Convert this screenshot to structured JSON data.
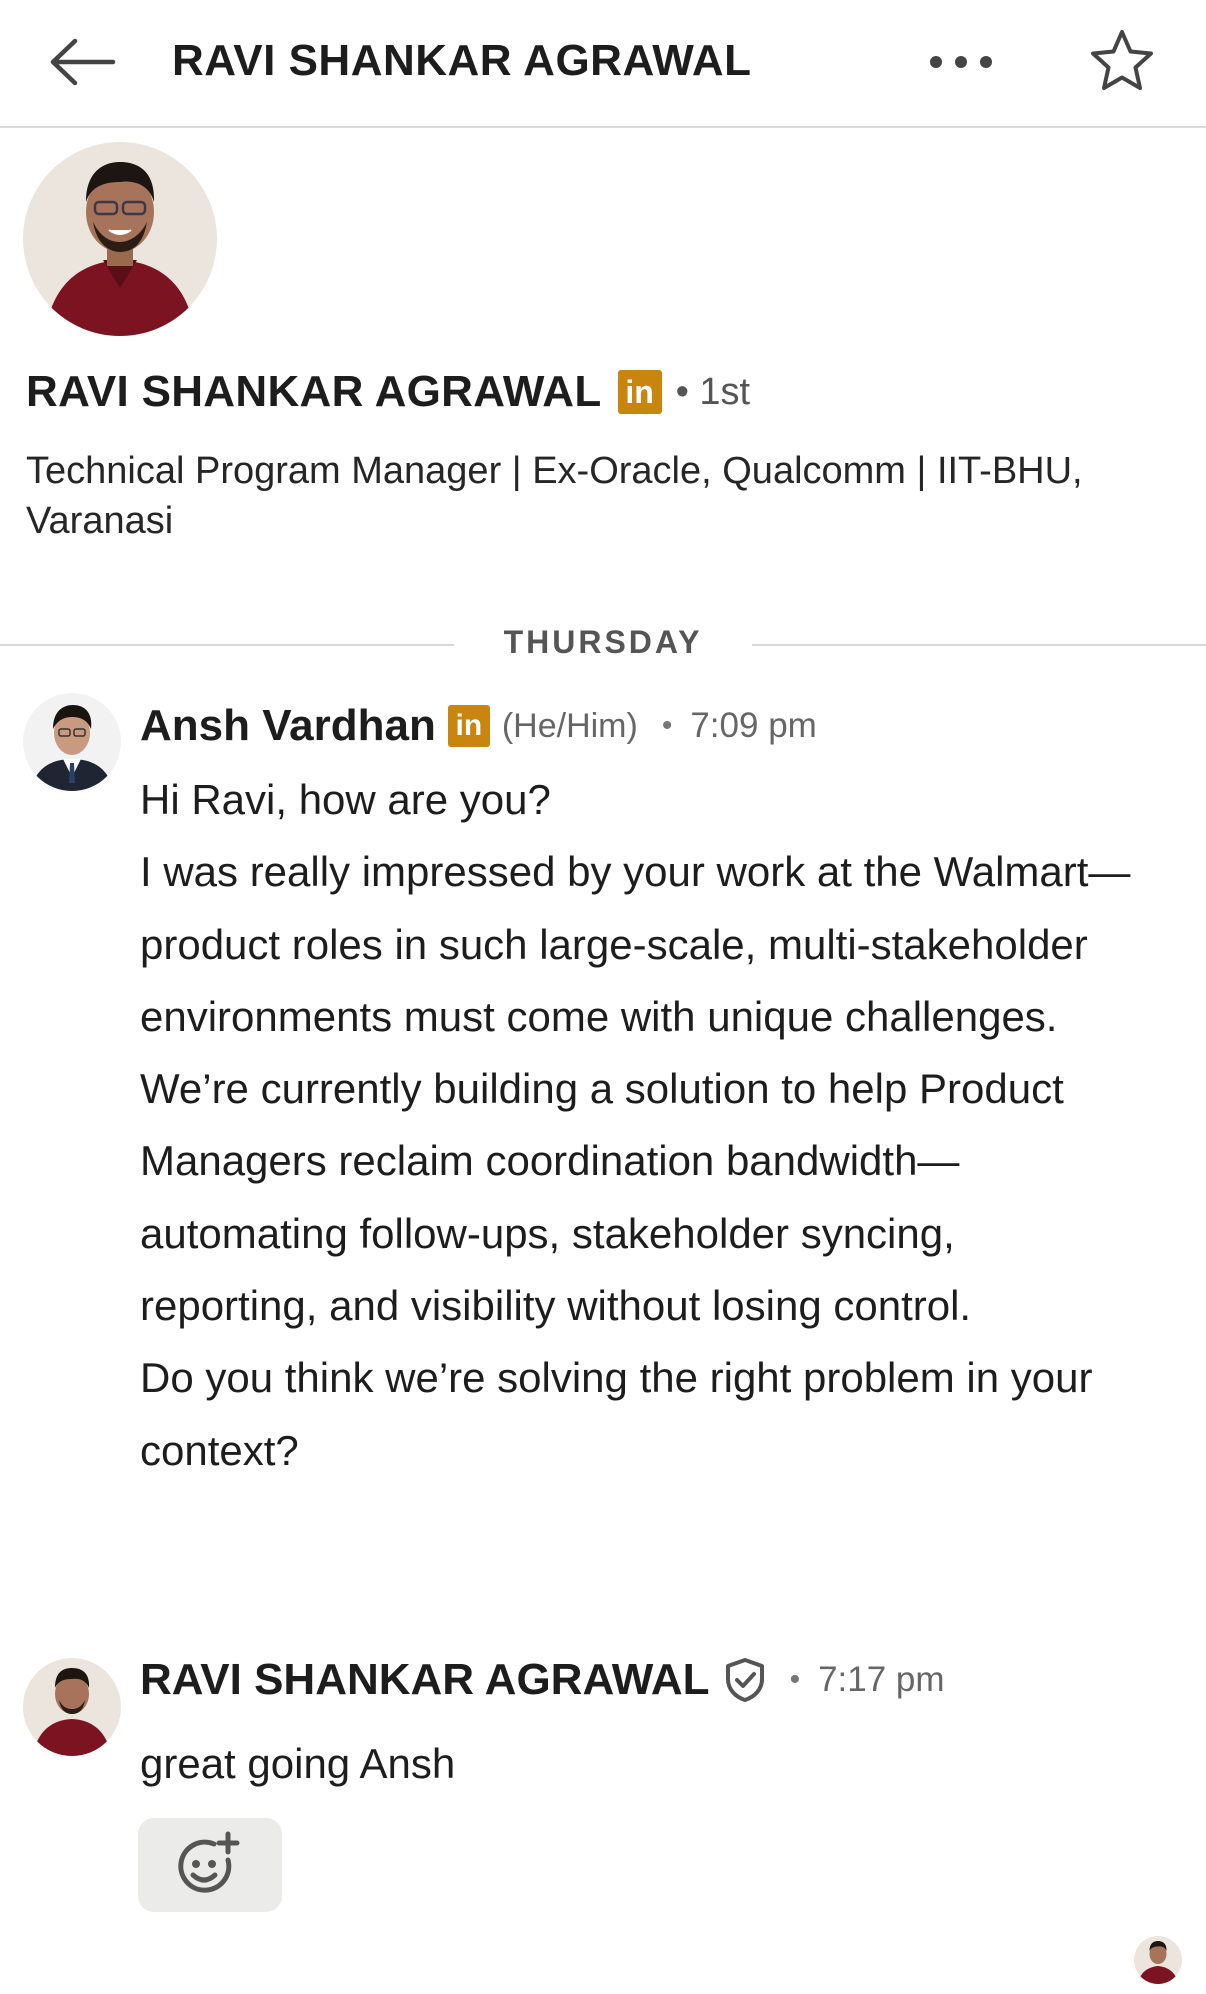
{
  "header": {
    "title": "RAVI SHANKAR AGRAWAL",
    "back_icon": "arrow-left-icon",
    "more_icon": "more-horizontal-icon",
    "star_icon": "star-outline-icon"
  },
  "profile": {
    "name": "RAVI SHANKAR AGRAWAL",
    "badge": "in",
    "degree": "• 1st",
    "headline": "Technical Program Manager | Ex-Oracle, Qualcomm | IIT-BHU, Varanasi"
  },
  "divider": {
    "label": "THURSDAY"
  },
  "messages": [
    {
      "sender": "Ansh Vardhan",
      "badge": "in",
      "pronouns": "(He/Him)",
      "dot": "•",
      "time": "7:09 pm",
      "lines": [
        "Hi Ravi, how are you?",
        "I was really impressed by your work at the Walmart—product roles in such large-scale, multi-stakeholder environments must come with unique challenges.",
        "We’re currently building a solution to help Product Managers reclaim coordination bandwidth—automating follow-ups, stakeholder syncing, reporting, and visibility without losing control.",
        "Do you think we’re solving the right problem in your context?"
      ]
    },
    {
      "sender": "RAVI SHANKAR AGRAWAL",
      "verified_icon": "shield-check-icon",
      "dot": "•",
      "time": "7:17 pm",
      "lines": [
        "great going Ansh"
      ]
    }
  ],
  "reaction_button_icon": "add-reaction-icon",
  "colors": {
    "linkedin_badge": "#c8860f",
    "divider": "#d9d9d9",
    "reaction_bg": "#ebebe9"
  }
}
